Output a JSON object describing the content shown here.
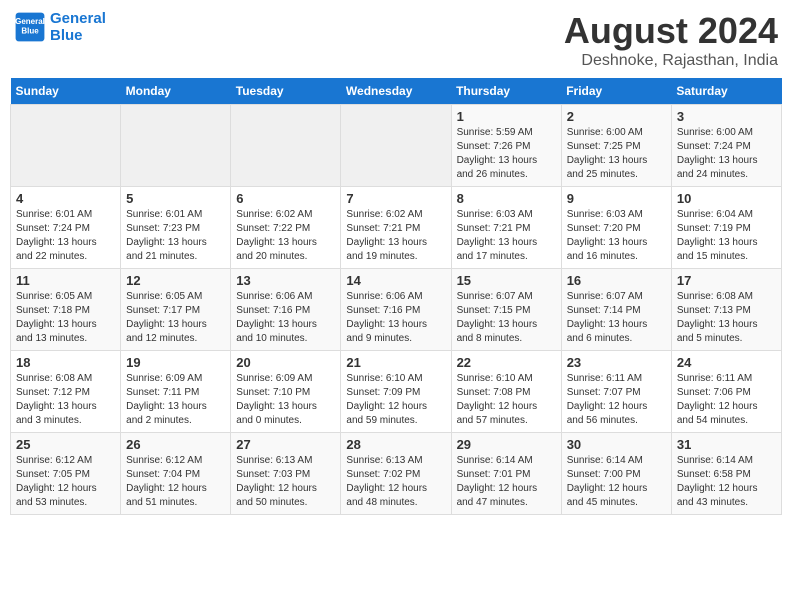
{
  "header": {
    "logo_line1": "General",
    "logo_line2": "Blue",
    "title": "August 2024",
    "subtitle": "Deshnoke, Rajasthan, India"
  },
  "days_of_week": [
    "Sunday",
    "Monday",
    "Tuesday",
    "Wednesday",
    "Thursday",
    "Friday",
    "Saturday"
  ],
  "weeks": [
    [
      {
        "day": "",
        "info": ""
      },
      {
        "day": "",
        "info": ""
      },
      {
        "day": "",
        "info": ""
      },
      {
        "day": "",
        "info": ""
      },
      {
        "day": "1",
        "info": "Sunrise: 5:59 AM\nSunset: 7:26 PM\nDaylight: 13 hours\nand 26 minutes."
      },
      {
        "day": "2",
        "info": "Sunrise: 6:00 AM\nSunset: 7:25 PM\nDaylight: 13 hours\nand 25 minutes."
      },
      {
        "day": "3",
        "info": "Sunrise: 6:00 AM\nSunset: 7:24 PM\nDaylight: 13 hours\nand 24 minutes."
      }
    ],
    [
      {
        "day": "4",
        "info": "Sunrise: 6:01 AM\nSunset: 7:24 PM\nDaylight: 13 hours\nand 22 minutes."
      },
      {
        "day": "5",
        "info": "Sunrise: 6:01 AM\nSunset: 7:23 PM\nDaylight: 13 hours\nand 21 minutes."
      },
      {
        "day": "6",
        "info": "Sunrise: 6:02 AM\nSunset: 7:22 PM\nDaylight: 13 hours\nand 20 minutes."
      },
      {
        "day": "7",
        "info": "Sunrise: 6:02 AM\nSunset: 7:21 PM\nDaylight: 13 hours\nand 19 minutes."
      },
      {
        "day": "8",
        "info": "Sunrise: 6:03 AM\nSunset: 7:21 PM\nDaylight: 13 hours\nand 17 minutes."
      },
      {
        "day": "9",
        "info": "Sunrise: 6:03 AM\nSunset: 7:20 PM\nDaylight: 13 hours\nand 16 minutes."
      },
      {
        "day": "10",
        "info": "Sunrise: 6:04 AM\nSunset: 7:19 PM\nDaylight: 13 hours\nand 15 minutes."
      }
    ],
    [
      {
        "day": "11",
        "info": "Sunrise: 6:05 AM\nSunset: 7:18 PM\nDaylight: 13 hours\nand 13 minutes."
      },
      {
        "day": "12",
        "info": "Sunrise: 6:05 AM\nSunset: 7:17 PM\nDaylight: 13 hours\nand 12 minutes."
      },
      {
        "day": "13",
        "info": "Sunrise: 6:06 AM\nSunset: 7:16 PM\nDaylight: 13 hours\nand 10 minutes."
      },
      {
        "day": "14",
        "info": "Sunrise: 6:06 AM\nSunset: 7:16 PM\nDaylight: 13 hours\nand 9 minutes."
      },
      {
        "day": "15",
        "info": "Sunrise: 6:07 AM\nSunset: 7:15 PM\nDaylight: 13 hours\nand 8 minutes."
      },
      {
        "day": "16",
        "info": "Sunrise: 6:07 AM\nSunset: 7:14 PM\nDaylight: 13 hours\nand 6 minutes."
      },
      {
        "day": "17",
        "info": "Sunrise: 6:08 AM\nSunset: 7:13 PM\nDaylight: 13 hours\nand 5 minutes."
      }
    ],
    [
      {
        "day": "18",
        "info": "Sunrise: 6:08 AM\nSunset: 7:12 PM\nDaylight: 13 hours\nand 3 minutes."
      },
      {
        "day": "19",
        "info": "Sunrise: 6:09 AM\nSunset: 7:11 PM\nDaylight: 13 hours\nand 2 minutes."
      },
      {
        "day": "20",
        "info": "Sunrise: 6:09 AM\nSunset: 7:10 PM\nDaylight: 13 hours\nand 0 minutes."
      },
      {
        "day": "21",
        "info": "Sunrise: 6:10 AM\nSunset: 7:09 PM\nDaylight: 12 hours\nand 59 minutes."
      },
      {
        "day": "22",
        "info": "Sunrise: 6:10 AM\nSunset: 7:08 PM\nDaylight: 12 hours\nand 57 minutes."
      },
      {
        "day": "23",
        "info": "Sunrise: 6:11 AM\nSunset: 7:07 PM\nDaylight: 12 hours\nand 56 minutes."
      },
      {
        "day": "24",
        "info": "Sunrise: 6:11 AM\nSunset: 7:06 PM\nDaylight: 12 hours\nand 54 minutes."
      }
    ],
    [
      {
        "day": "25",
        "info": "Sunrise: 6:12 AM\nSunset: 7:05 PM\nDaylight: 12 hours\nand 53 minutes."
      },
      {
        "day": "26",
        "info": "Sunrise: 6:12 AM\nSunset: 7:04 PM\nDaylight: 12 hours\nand 51 minutes."
      },
      {
        "day": "27",
        "info": "Sunrise: 6:13 AM\nSunset: 7:03 PM\nDaylight: 12 hours\nand 50 minutes."
      },
      {
        "day": "28",
        "info": "Sunrise: 6:13 AM\nSunset: 7:02 PM\nDaylight: 12 hours\nand 48 minutes."
      },
      {
        "day": "29",
        "info": "Sunrise: 6:14 AM\nSunset: 7:01 PM\nDaylight: 12 hours\nand 47 minutes."
      },
      {
        "day": "30",
        "info": "Sunrise: 6:14 AM\nSunset: 7:00 PM\nDaylight: 12 hours\nand 45 minutes."
      },
      {
        "day": "31",
        "info": "Sunrise: 6:14 AM\nSunset: 6:58 PM\nDaylight: 12 hours\nand 43 minutes."
      }
    ]
  ]
}
